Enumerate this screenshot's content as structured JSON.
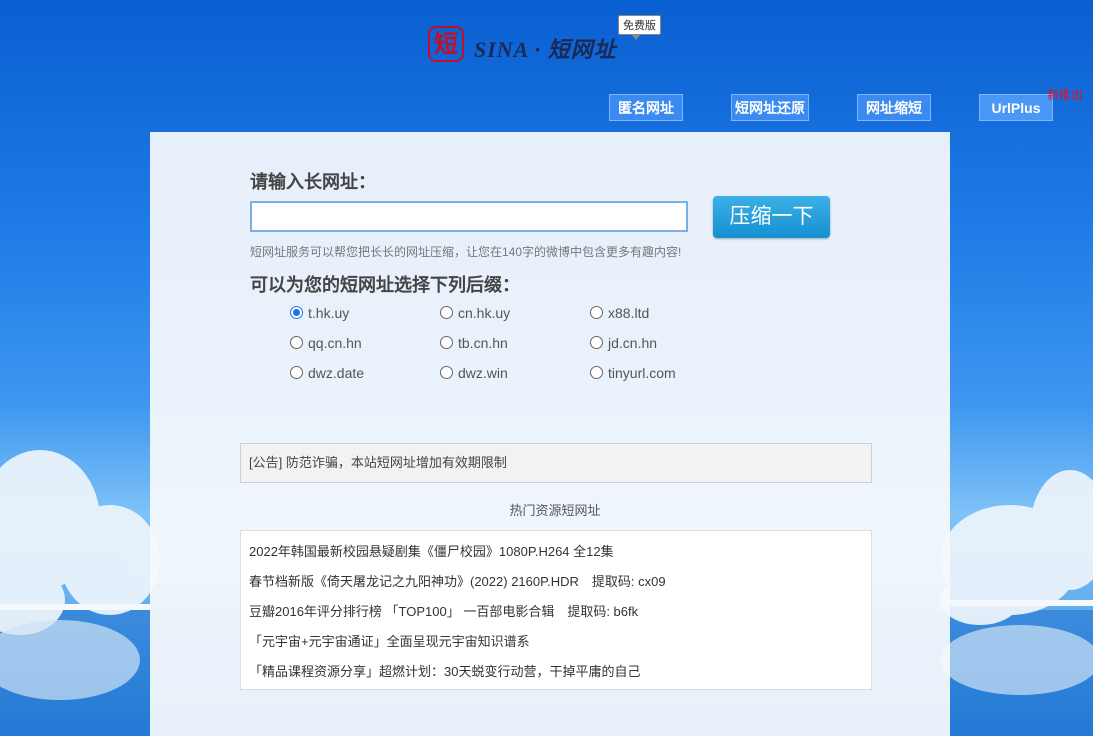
{
  "header": {
    "logo_char": "短",
    "logo_text": "SINA · 短网址",
    "badge": "免费版"
  },
  "nav": {
    "items": [
      {
        "label": "匿名网址"
      },
      {
        "label": "短网址还原"
      },
      {
        "label": "网址缩短"
      },
      {
        "label": "UrlPlus"
      }
    ],
    "new_tag": "新推出"
  },
  "form": {
    "title": "请输入长网址：",
    "input_value": "",
    "submit_label": "压缩一下",
    "hint": "短网址服务可以帮您把长长的网址压缩，让您在140字的微博中包含更多有趣内容!",
    "suffix_title": "可以为您的短网址选择下列后缀：",
    "suffixes": [
      {
        "label": "t.hk.uy",
        "checked": true
      },
      {
        "label": "cn.hk.uy",
        "checked": false
      },
      {
        "label": "x88.ltd",
        "checked": false
      },
      {
        "label": "qq.cn.hn",
        "checked": false
      },
      {
        "label": "tb.cn.hn",
        "checked": false
      },
      {
        "label": "jd.cn.hn",
        "checked": false
      },
      {
        "label": "dwz.date",
        "checked": false
      },
      {
        "label": "dwz.win",
        "checked": false
      },
      {
        "label": "tinyurl.com",
        "checked": false
      }
    ]
  },
  "notice": "[公告] 防范诈骗，本站短网址增加有效期限制",
  "hot": {
    "title": "热门资源短网址",
    "items": [
      "2022年韩国最新校园悬疑剧集《僵尸校园》1080P.H264 全12集",
      "春节档新版《倚天屠龙记之九阳神功》(2022) 2160P.HDR　提取码: cx09",
      "豆瓣2016年评分排行榜 「TOP100」 一百部电影合辑　提取码: b6fk",
      "「元宇宙+元宇宙通证」全面呈现元宇宙知识谱系",
      "「精品课程资源分享」超燃计划：30天蜕变行动营，干掉平庸的自己"
    ]
  }
}
